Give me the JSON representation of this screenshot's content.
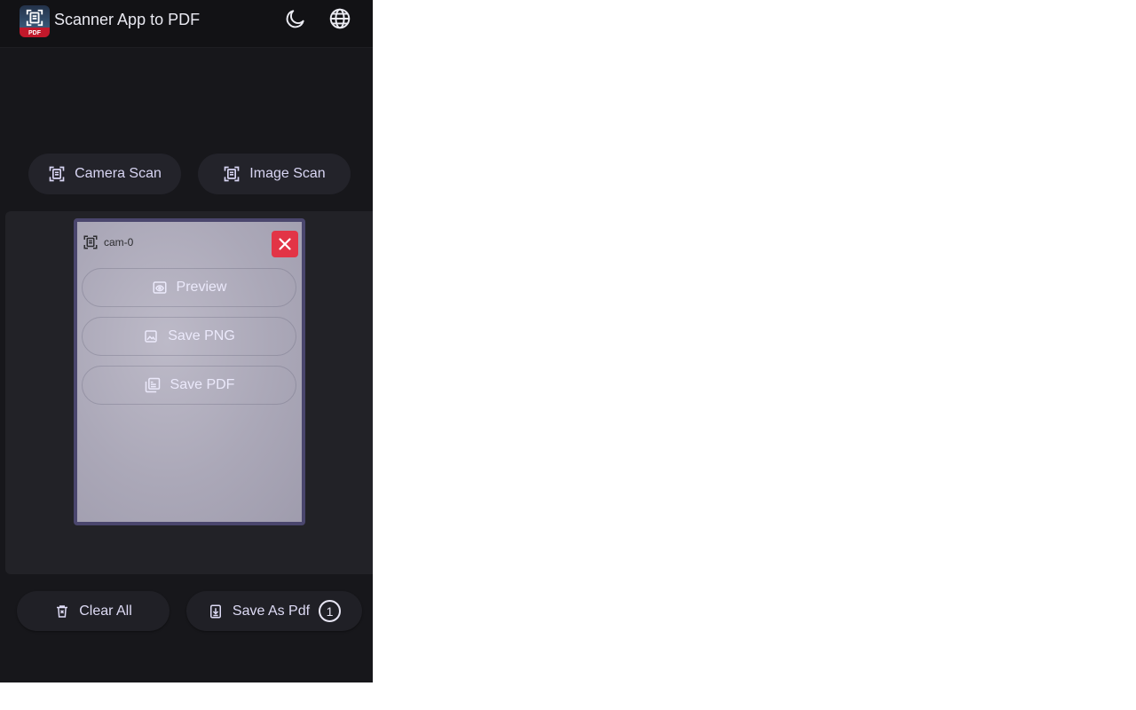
{
  "header": {
    "title": "Scanner App to PDF",
    "logo_badge": "PDF",
    "logo_icon": "document-scanner-icon",
    "theme_icon": "moon-icon",
    "language_icon": "globe-icon"
  },
  "scan_buttons": {
    "camera": "Camera Scan",
    "image": "Image Scan"
  },
  "scans": [
    {
      "name": "cam-0",
      "actions": {
        "preview": "Preview",
        "save_png": "Save PNG",
        "save_pdf": "Save PDF"
      }
    }
  ],
  "footer": {
    "clear_all": "Clear All",
    "save_as_pdf": "Save As Pdf",
    "count": "1"
  },
  "colors": {
    "background": "#17171b",
    "accent": "#d8d5f3",
    "card_border": "#4a466d",
    "close": "#e23446"
  }
}
